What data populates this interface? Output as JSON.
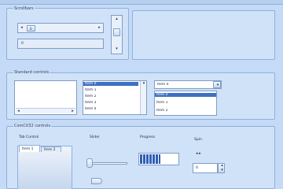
{
  "window": {
    "accent": "#3f70c3",
    "background": "#c4daf6"
  },
  "groups": {
    "top_left": {
      "title": "Scrollbars"
    },
    "standard": {
      "title": "Standard controls"
    },
    "common": {
      "title": "ComCtl32 controls"
    }
  },
  "scrollbars": {
    "thumb_caption": "0",
    "value_field": "0",
    "left_arrow": "◂",
    "right_arrow": "▸",
    "up_arrow": "▴",
    "down_arrow": "▾"
  },
  "standard": {
    "listbox_items": [
      "Item 0",
      "Item 1",
      "Item 2",
      "Item 3",
      "Item 4"
    ],
    "combo_value": "Item 0",
    "combo_items": [
      "Item 0",
      "Item 1",
      "Item 2"
    ],
    "dropdown_arrow": "▾"
  },
  "common": {
    "tab_control_label": "Tab Control",
    "tabs": [
      "Item 1",
      "Item 2"
    ],
    "slider_label": "Slider",
    "progress_label": "Progress",
    "progress_value": 0.55,
    "spin_label": "Spin",
    "spin_value": "0",
    "spin_arrows": "◂ ▸"
  }
}
